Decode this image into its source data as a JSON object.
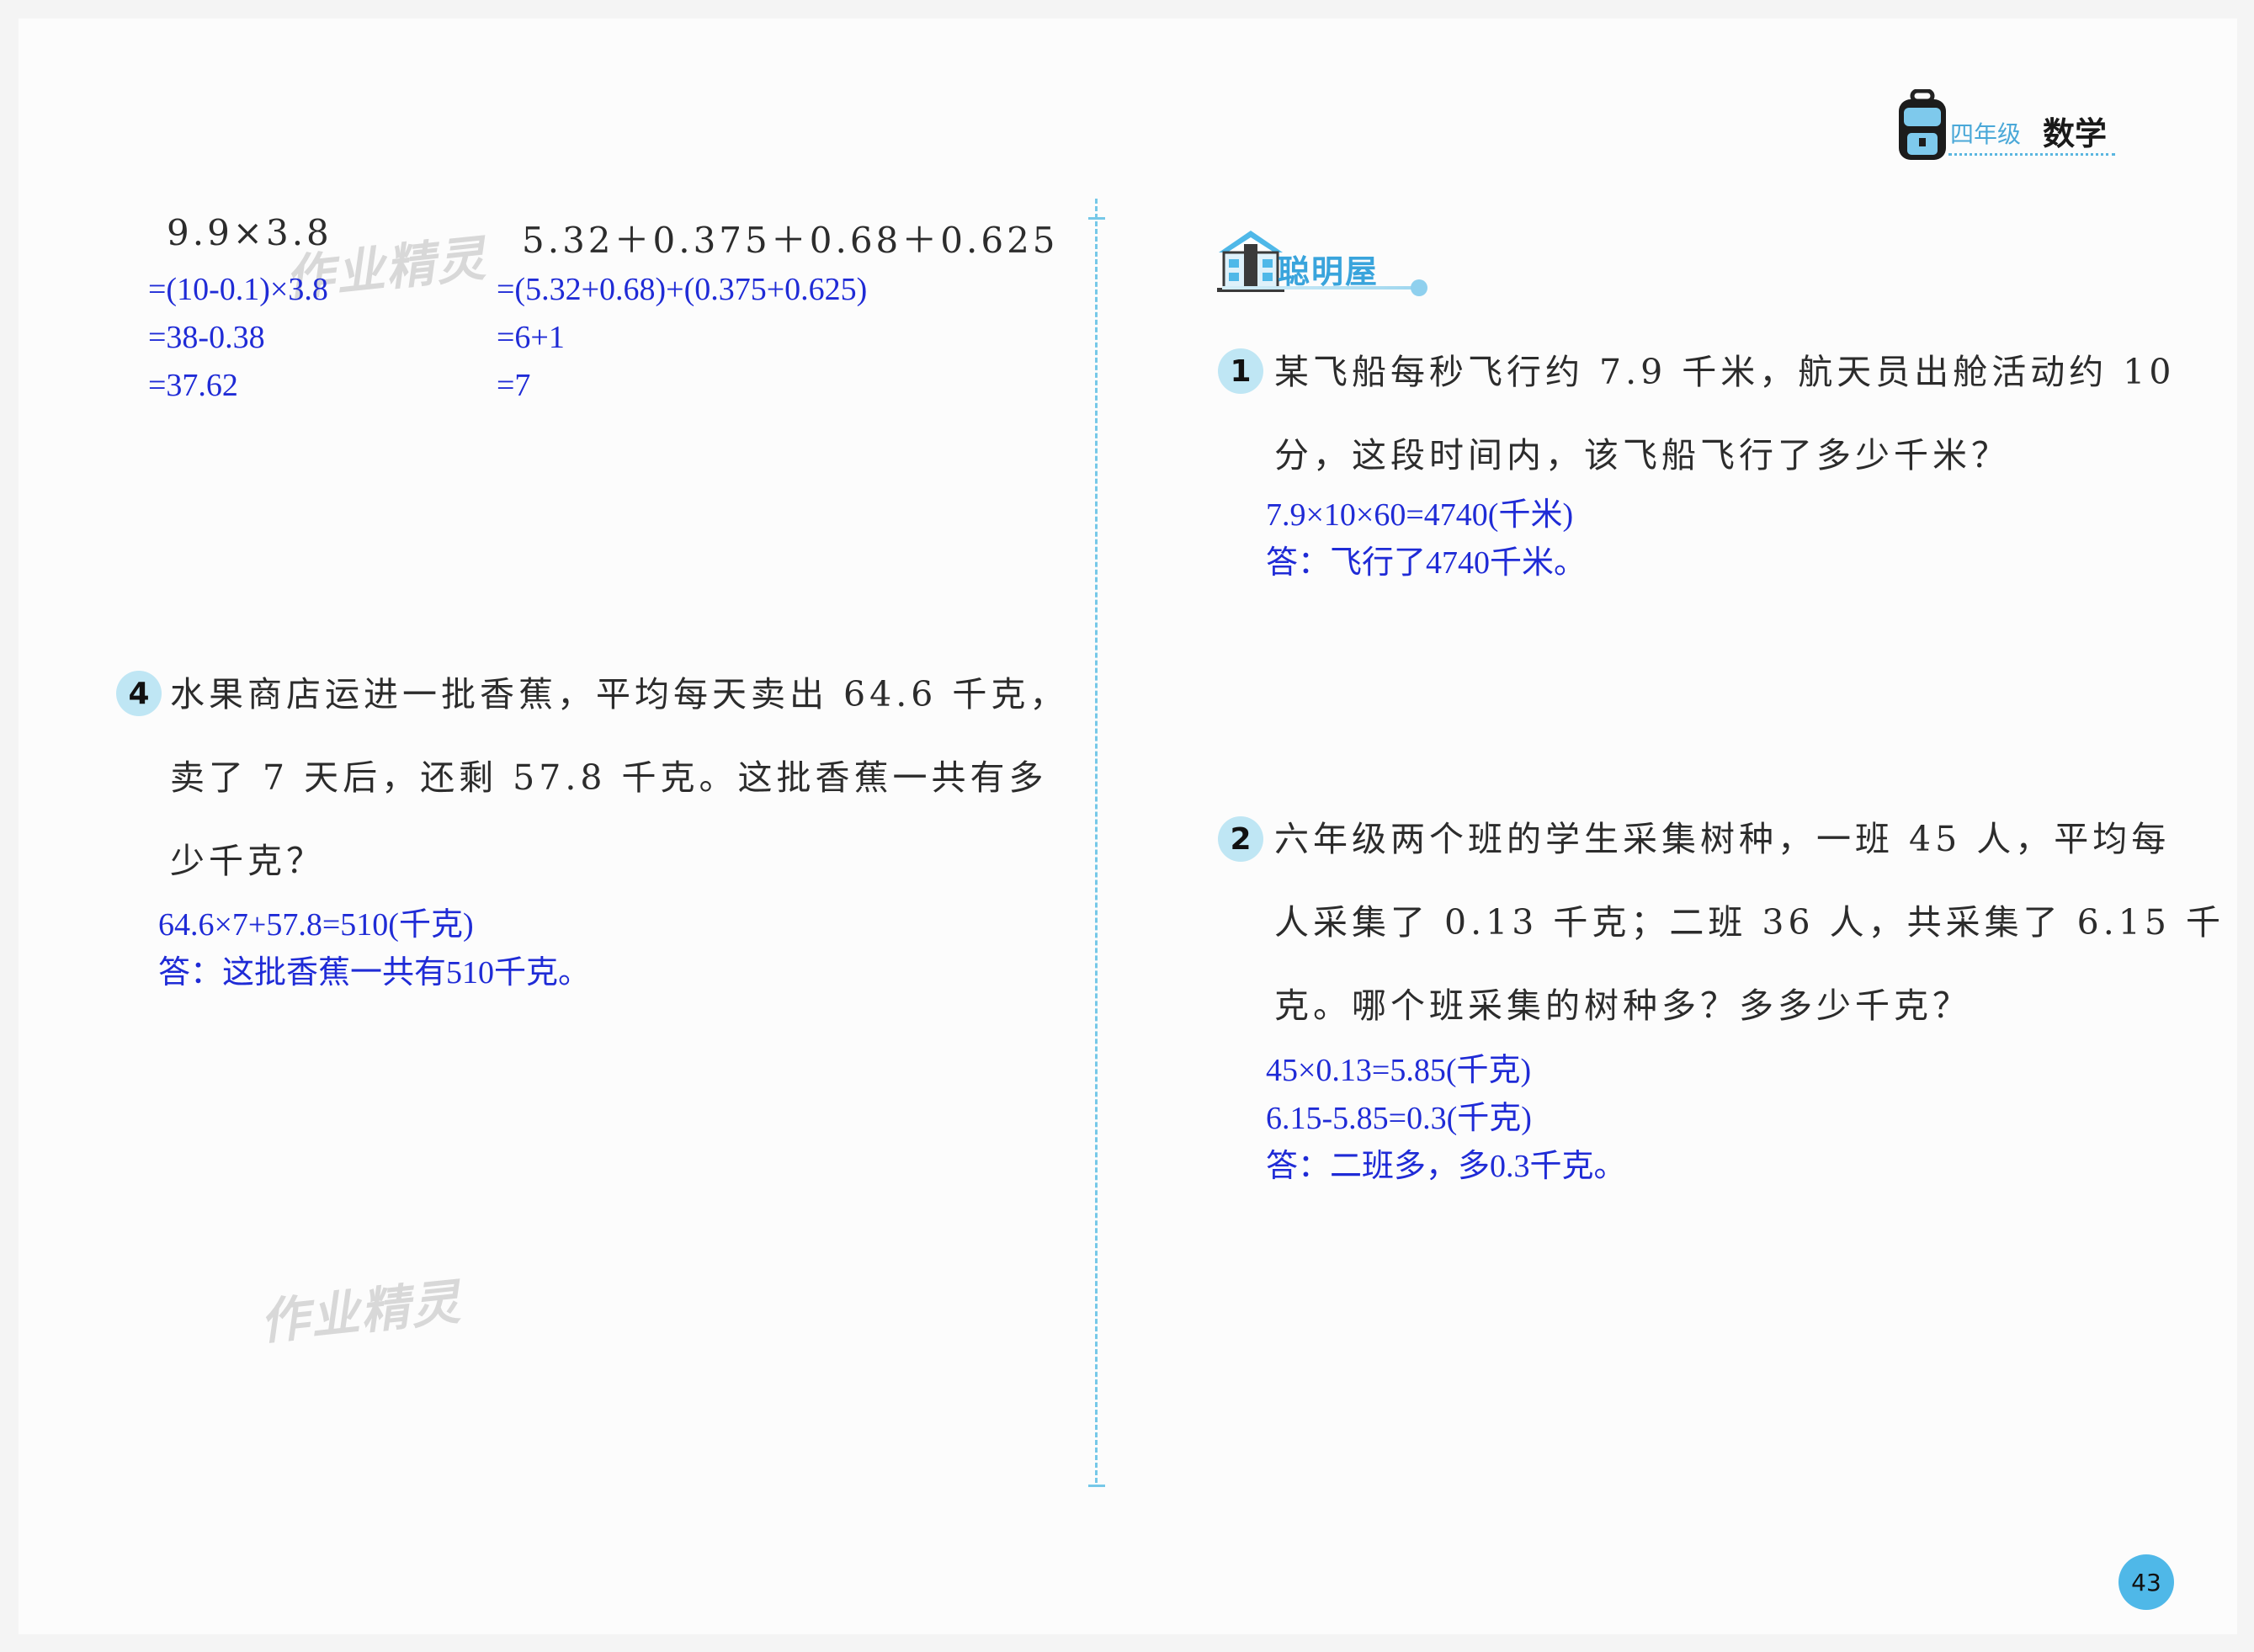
{
  "header": {
    "grade": "四年级",
    "subject": "数学",
    "page_number": "43"
  },
  "watermark": "作业精灵",
  "left": {
    "calc1": {
      "expression": "9.9×3.8",
      "steps": [
        "=(10-0.1)×3.8",
        "=38-0.38",
        "=37.62"
      ]
    },
    "calc2": {
      "expression": "5.32＋0.375＋0.68＋0.625",
      "steps": [
        "=(5.32+0.68)+(0.375+0.625)",
        "=6+1",
        "=7"
      ]
    },
    "q4": {
      "number": "4",
      "lines": [
        "水果商店运进一批香蕉，平均每天卖出 64.6 千克，",
        "卖了 7 天后，还剩 57.8 千克。这批香蕉一共有多",
        "少千克？"
      ],
      "answer": [
        "64.6×7+57.8=510(千克)",
        "答：这批香蕉一共有510千克。"
      ]
    }
  },
  "right": {
    "section_title": "聪明屋",
    "q1": {
      "number": "1",
      "lines": [
        "某飞船每秒飞行约 7.9 千米，航天员出舱活动约 10",
        "分，这段时间内，该飞船飞行了多少千米？"
      ],
      "answer": [
        "7.9×10×60=4740(千米)",
        "答：飞行了4740千米。"
      ]
    },
    "q2": {
      "number": "2",
      "lines": [
        "六年级两个班的学生采集树种，一班 45 人，平均每",
        "人采集了 0.13 千克；二班 36 人，共采集了 6.15 千",
        "克。哪个班采集的树种多？多多少千克？"
      ],
      "answer": [
        "45×0.13=5.85(千克)",
        "6.15-5.85=0.3(千克)",
        "答：二班多，多0.3千克。"
      ]
    }
  },
  "colors": {
    "accent_blue": "#39a4dc",
    "answer_blue": "#1f2bd6",
    "badge_bg": "#bfe6f4"
  },
  "icons": {
    "header": "backpack-icon",
    "section": "house-icon"
  }
}
